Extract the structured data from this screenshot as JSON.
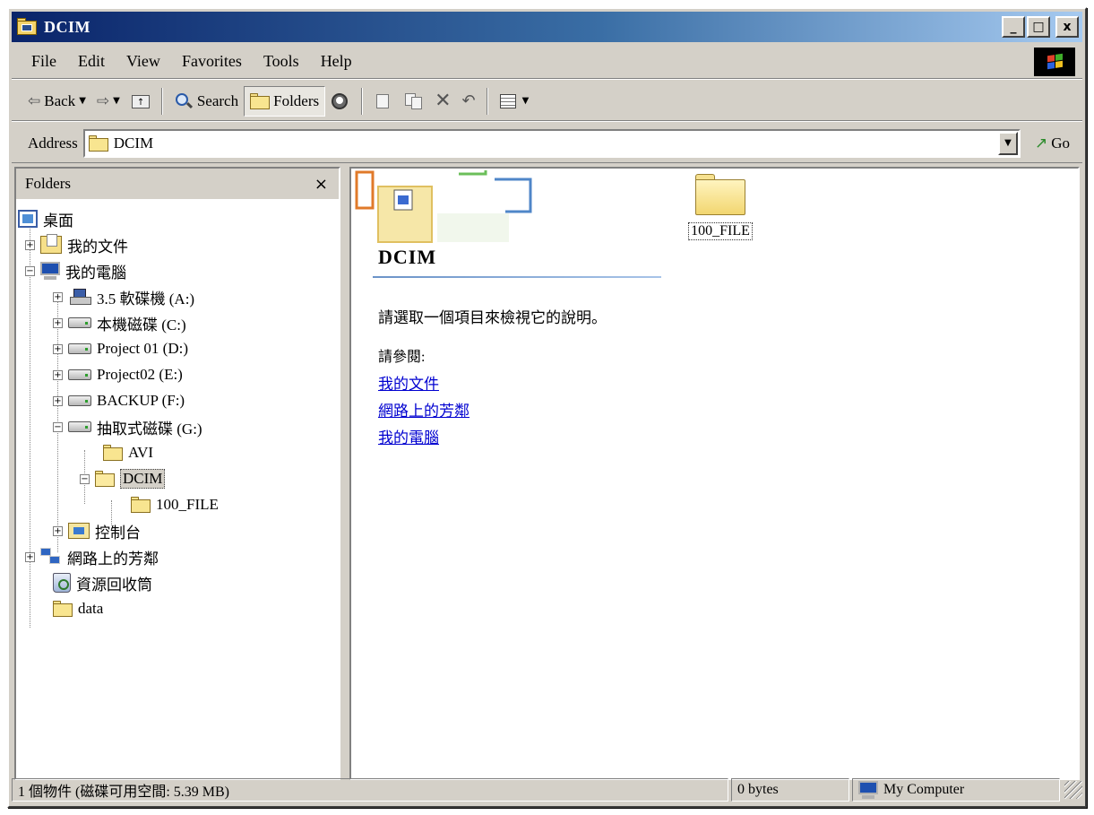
{
  "window": {
    "title": "DCIM",
    "controls": {
      "minimize": "_",
      "maximize": "□",
      "close": "x"
    }
  },
  "menu": [
    {
      "name": "file",
      "label": "File"
    },
    {
      "name": "edit",
      "label": "Edit"
    },
    {
      "name": "view",
      "label": "View"
    },
    {
      "name": "favorites",
      "label": "Favorites"
    },
    {
      "name": "tools",
      "label": "Tools"
    },
    {
      "name": "help",
      "label": "Help"
    }
  ],
  "toolbar": {
    "back_label": "Back",
    "search_label": "Search",
    "folders_label": "Folders"
  },
  "address": {
    "label": "Address",
    "value": "DCIM",
    "go_label": "Go"
  },
  "folders_pane": {
    "title": "Folders",
    "close": "×",
    "items": [
      {
        "label": "桌面"
      },
      {
        "label": "我的文件"
      },
      {
        "label": "我的電腦"
      },
      {
        "label": "3.5 軟碟機 (A:)"
      },
      {
        "label": "本機磁碟 (C:)"
      },
      {
        "label": "Project 01 (D:)"
      },
      {
        "label": "Project02 (E:)"
      },
      {
        "label": "BACKUP (F:)"
      },
      {
        "label": "抽取式磁碟 (G:)"
      },
      {
        "label": "AVI"
      },
      {
        "label": "DCIM"
      },
      {
        "label": "100_FILE"
      },
      {
        "label": "控制台"
      },
      {
        "label": "網路上的芳鄰"
      },
      {
        "label": "資源回收筒"
      },
      {
        "label": "data"
      }
    ]
  },
  "content": {
    "heading": "DCIM",
    "description": "請選取一個項目來檢視它的說明。",
    "see_also_label": "請參閱:",
    "links": [
      {
        "label": "我的文件"
      },
      {
        "label": "網路上的芳鄰"
      },
      {
        "label": "我的電腦"
      }
    ],
    "files": [
      {
        "label": "100_FILE"
      }
    ]
  },
  "statusbar": {
    "objects": "1 個物件 (磁碟可用空間: 5.39 MB)",
    "size": "0 bytes",
    "zone": "My Computer"
  }
}
